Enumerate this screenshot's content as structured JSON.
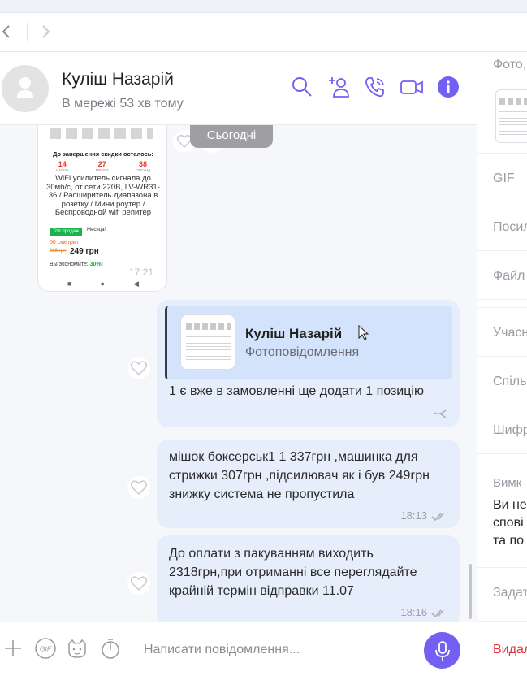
{
  "chat": {
    "contact_name": "Куліш Назарій",
    "status": "В мережі 53 хв тому"
  },
  "messages": {
    "date_separator": "Сьогодні",
    "photo_card": {
      "title": "До завершения скидки осталось:",
      "countdown": [
        {
          "value": "14",
          "unit": "ЧАСОВ"
        },
        {
          "value": "27",
          "unit": "МИНУТ"
        },
        {
          "value": "38",
          "unit": "СЕКУНД"
        }
      ],
      "description": "WiFi усилитель сигнала до 30мб/с, от сети 220В, LV-WR31-36 / Расширитель диапазона в розетку / Мини роутер / Беспроводной wifi репитер",
      "badge_top": "Топ продаж",
      "badge_month": "Месяца!",
      "sold": "50 сметрит",
      "old_price": "398 грн",
      "price": "249 грн",
      "savings_label": "Вы экономите:",
      "savings_value": "30%!",
      "time": "17:21",
      "nav": [
        "■",
        "●",
        "◀"
      ]
    },
    "reply": {
      "quote_name": "Куліш Назарій",
      "quote_sub": "Фотоповідомлення",
      "text": "1 є вже в замовленні ще додати 1 позицію"
    },
    "msg2": {
      "text": "мішок боксерськ1 1 337грн ,машинка для стрижки 307грн ,підсилювач як і був 249грн знижку система не пропустила",
      "time": "18:13"
    },
    "msg3": {
      "text": "До оплати з пакуванням виходить 2318грн,при отриманні все переглядайте крайній термін відправки 11.07",
      "time": "18:16"
    }
  },
  "composer": {
    "placeholder": "Написати повідомлення..."
  },
  "sidebar": {
    "items": [
      "Фото,",
      "GIF",
      "Посил",
      "Файл",
      "Учасн",
      "Спіль",
      "Шифр",
      "Вимк"
    ],
    "mute_desc": [
      "Ви не",
      "спові",
      "та по"
    ],
    "set_item": "Задат",
    "delete": "Видал"
  },
  "colors": {
    "accent": "#7360f2",
    "bubble": "#e7eefb",
    "quote": "#d2e3fb",
    "delete": "#e2333e"
  }
}
